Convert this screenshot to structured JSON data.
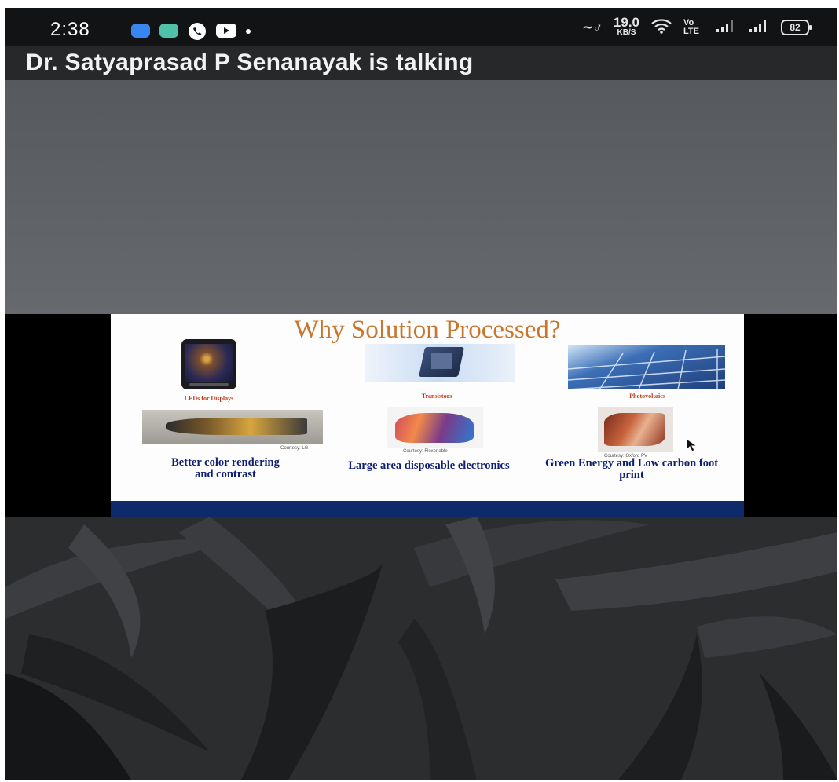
{
  "status_bar": {
    "time": "2:38",
    "net_speed_value": "19.0",
    "net_speed_unit": "KB/S",
    "volte_label": "Vo LTE",
    "battery": "82",
    "notification_icons": [
      "messages-icon",
      "app-icon",
      "phone-icon",
      "youtube-icon",
      "more-dot-icon"
    ]
  },
  "meeting": {
    "speaker_status": "Dr. Satyaprasad P Senanayak is talking"
  },
  "slide": {
    "title": "Why Solution Processed?",
    "items": [
      {
        "caption": "LEDs for Displays"
      },
      {
        "caption": "Transistors"
      },
      {
        "caption": "Photovoltaics"
      }
    ],
    "credits": [
      "Courtesy: LG",
      "Courtesy: Flexenable",
      "Courtesy: Oxford PV"
    ],
    "benefits": [
      "Better color rendering and contrast",
      "Large area disposable electronics",
      "Green Energy and Low carbon foot print"
    ]
  },
  "colors": {
    "slide_title": "#c8762d",
    "benefit_text": "#0d1e73",
    "caption_text": "#c0391b",
    "slide_footer": "#0e2a6b",
    "title_bar": "#262829"
  }
}
